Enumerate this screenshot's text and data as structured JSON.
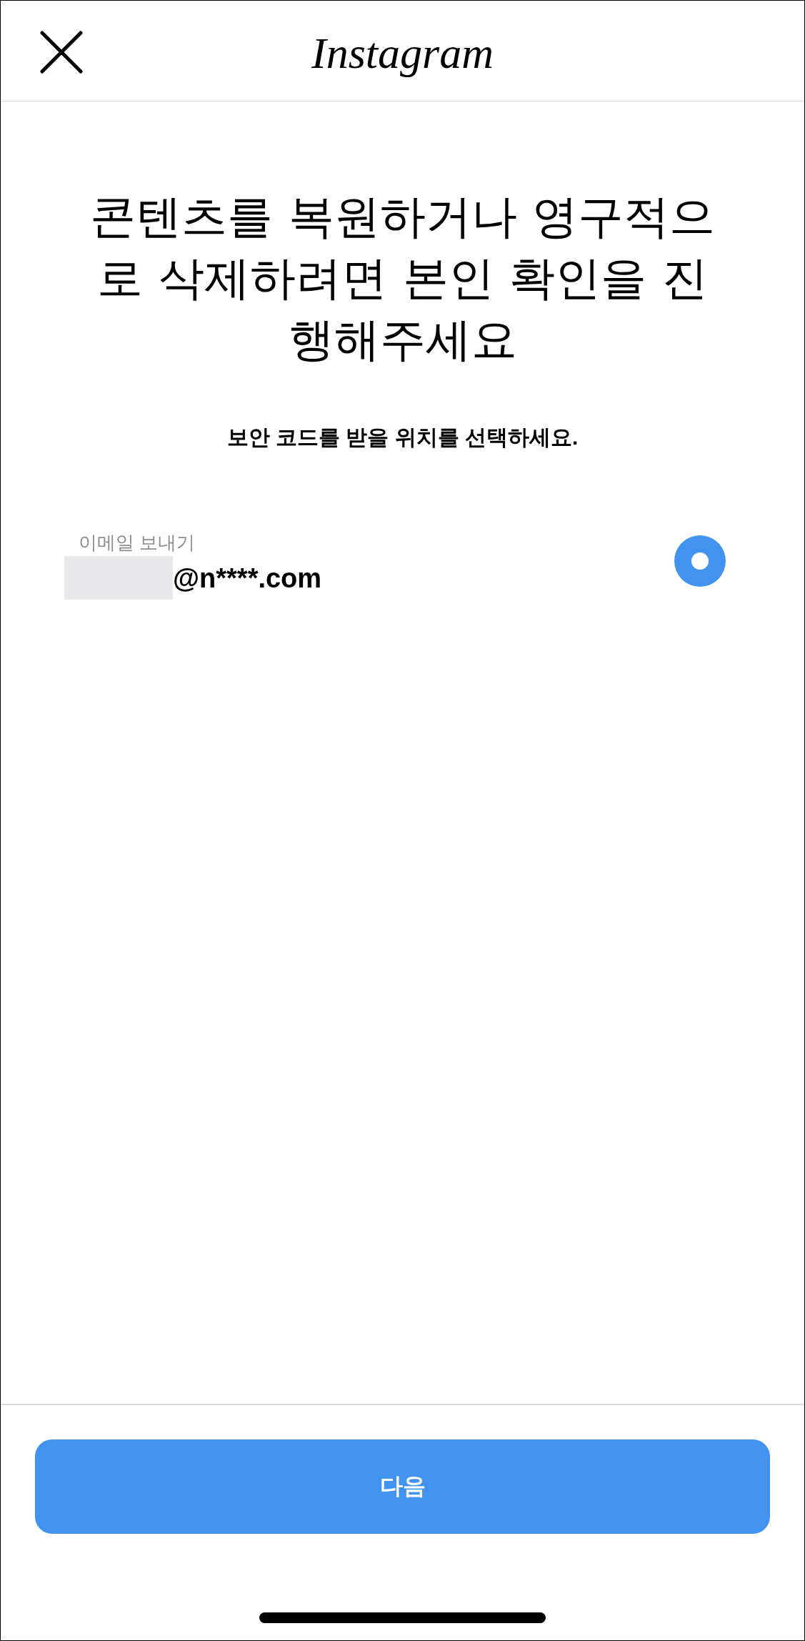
{
  "header": {
    "logo": "Instagram"
  },
  "title": "콘텐츠를 복원하거나 영구적으로 삭제하려면 본인 확인을 진행해주세요",
  "subtitle": "보안 코드를 받을 위치를 선택하세요.",
  "options": [
    {
      "label": "이메일 보내기",
      "value": "@n****.com",
      "redacted": true,
      "selected": true
    }
  ],
  "footer": {
    "button": "다음"
  }
}
